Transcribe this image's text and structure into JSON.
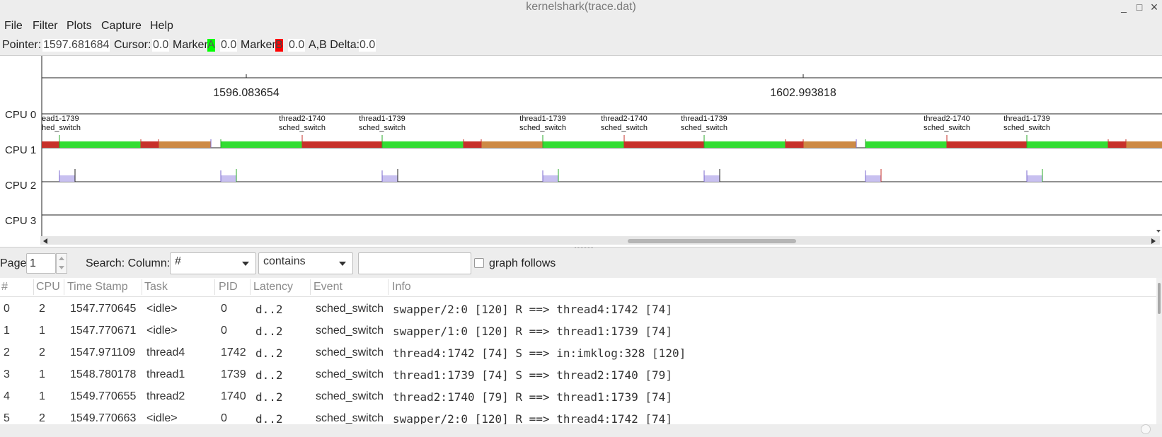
{
  "window": {
    "title": "kernelshark(trace.dat)",
    "buttons": [
      "_",
      "□",
      "×"
    ]
  },
  "menu": [
    "File",
    "Filter",
    "Plots",
    "Capture",
    "Help"
  ],
  "infobar": {
    "pointer_label": "Pointer:",
    "pointer_value": "1597.681684",
    "cursor_label": "Cursor:",
    "cursor_value": "0.0",
    "marker_a_label": "Marker",
    "marker_a_letter": "A",
    "marker_a_value": "0.0",
    "marker_b_label": "Marker",
    "marker_b_letter": "B",
    "marker_b_value": "0.0",
    "delta_label": "A,B Delta:",
    "delta_value": "0.0"
  },
  "timeline": {
    "ticks": [
      "1596.083654",
      "1602.993818"
    ]
  },
  "cpus": [
    "CPU 0",
    "CPU 1",
    "CPU 2",
    "CPU 3"
  ],
  "events": [
    {
      "task": "ead1-1739",
      "event": "hed_switch"
    },
    {
      "task": "thread2-1740",
      "event": "sched_switch"
    },
    {
      "task": "thread1-1739",
      "event": "sched_switch"
    },
    {
      "task": "thread1-1739",
      "event": "sched_switch"
    },
    {
      "task": "thread2-1740",
      "event": "sched_switch"
    },
    {
      "task": "thread1-1739",
      "event": "sched_switch"
    },
    {
      "task": "thread2-1740",
      "event": "sched_switch"
    },
    {
      "task": "thread1-1739",
      "event": "sched_switch"
    }
  ],
  "colors": {
    "green": "#33dd33",
    "red": "#c7302a",
    "orange": "#cd8a45",
    "lavender": "#c8c0f0",
    "marker_a": "#00ff00",
    "marker_b": "#ff0000"
  },
  "search": {
    "page_label": "Page",
    "page_value": "1",
    "search_label": "Search: Column:",
    "column_value": "#",
    "match_value": "contains",
    "text_value": "",
    "graph_follows_label": "graph follows"
  },
  "table": {
    "headers": [
      "#",
      "CPU",
      "Time Stamp",
      "Task",
      "PID",
      "Latency",
      "Event",
      "Info"
    ],
    "rows": [
      [
        "0",
        "2",
        "1547.770645",
        "<idle>",
        "0",
        "d..2",
        "sched_switch",
        "swapper/2:0 [120] R ==> thread4:1742 [74]"
      ],
      [
        "1",
        "1",
        "1547.770671",
        "<idle>",
        "0",
        "d..2",
        "sched_switch",
        "swapper/1:0 [120] R ==> thread1:1739 [74]"
      ],
      [
        "2",
        "2",
        "1547.971109",
        "thread4",
        "1742",
        "d..2",
        "sched_switch",
        "thread4:1742 [74] S ==> in:imklog:328 [120]"
      ],
      [
        "3",
        "1",
        "1548.780178",
        "thread1",
        "1739",
        "d..2",
        "sched_switch",
        "thread1:1739 [74] S ==> thread2:1740 [79]"
      ],
      [
        "4",
        "1",
        "1549.770655",
        "thread2",
        "1740",
        "d..2",
        "sched_switch",
        "thread2:1740 [79] R ==> thread1:1739 [74]"
      ],
      [
        "5",
        "2",
        "1549.770663",
        "<idle>",
        "0",
        "d..2",
        "sched_switch",
        "swapper/2:0 [120] R ==> thread4:1742 [74]"
      ]
    ]
  }
}
